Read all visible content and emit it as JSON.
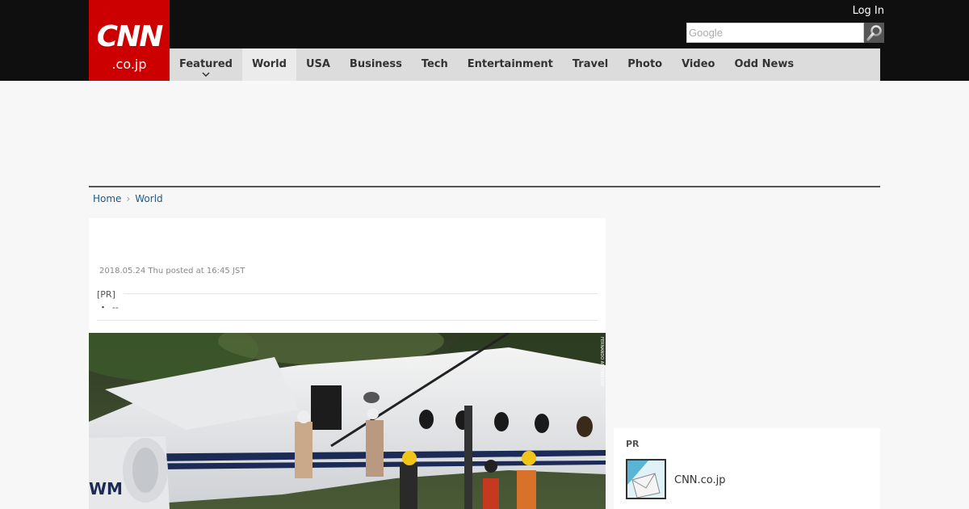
{
  "header": {
    "logo_main": "CNN",
    "logo_sub": ".co.jp",
    "login_label": "Log In",
    "search_placeholder": "Google"
  },
  "nav": {
    "items": [
      {
        "label": "Featured"
      },
      {
        "label": "World"
      },
      {
        "label": "USA"
      },
      {
        "label": "Business"
      },
      {
        "label": "Tech"
      },
      {
        "label": "Entertainment"
      },
      {
        "label": "Travel"
      },
      {
        "label": "Photo"
      },
      {
        "label": "Video"
      },
      {
        "label": "Odd News"
      }
    ],
    "active": "World"
  },
  "breadcrumb": {
    "home": "Home",
    "separator": "›",
    "current": "World"
  },
  "article": {
    "posted": "2018.05.24 Thu posted at 16:45 JST",
    "pr_label": "[PR]",
    "pr_link_bullet": "・",
    "pr_link_text": "--",
    "photo_credit": "FERNANDO ANTONIO/AP",
    "photo_plane_text": "WM"
  },
  "sidebar": {
    "pr_title": "PR",
    "pr_item_name": "CNN.co.jp",
    "pr_item_icon": "envelope-icon"
  },
  "colors": {
    "brand_red": "#cc0000",
    "topbar": "#0f0f0f",
    "nav_bg": "#dcdcdc",
    "link": "#1c5a8a"
  }
}
